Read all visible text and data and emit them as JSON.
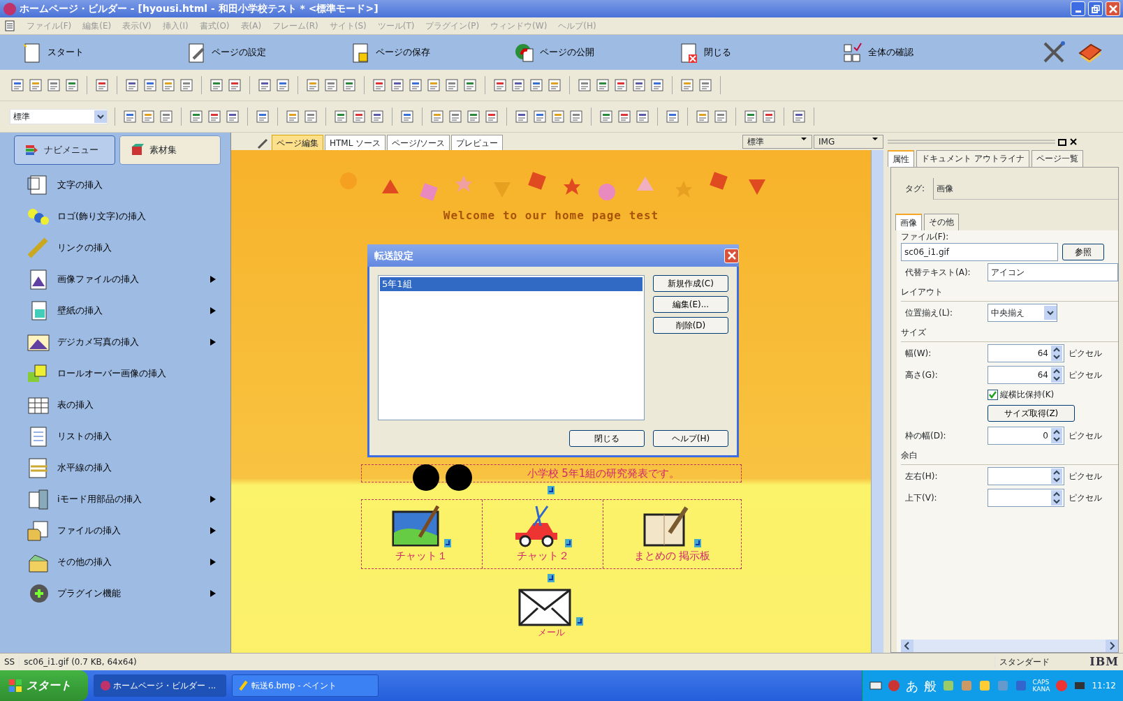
{
  "window": {
    "title": "ホームページ・ビルダー - [hyousi.html - 和田小学校テスト * <標準モード>]"
  },
  "menu": [
    "ファイル(F)",
    "編集(E)",
    "表示(V)",
    "挿入(I)",
    "書式(O)",
    "表(A)",
    "フレーム(R)",
    "サイト(S)",
    "ツール(T)",
    "プラグイン(P)",
    "ウィンドウ(W)",
    "ヘルプ(H)"
  ],
  "task_bar": [
    {
      "label": "スタート",
      "kind": "page"
    },
    {
      "label": "ページの設定",
      "kind": "settings"
    },
    {
      "label": "ページの保存",
      "kind": "save"
    },
    {
      "label": "ページの公開",
      "kind": "publish"
    },
    {
      "label": "閉じる",
      "kind": "close"
    },
    {
      "label": "全体の確認",
      "kind": "check"
    }
  ],
  "format_bar": {
    "style": "標準"
  },
  "sidebar": {
    "tabs": [
      {
        "label": "ナビメニュー",
        "selected": true
      },
      {
        "label": "素材集",
        "selected": false
      }
    ],
    "items": [
      {
        "label": "文字の挿入",
        "submenu": false
      },
      {
        "label": "ロゴ(飾り文字)の挿入",
        "submenu": false
      },
      {
        "label": "リンクの挿入",
        "submenu": false
      },
      {
        "label": "画像ファイルの挿入",
        "submenu": true
      },
      {
        "label": "壁紙の挿入",
        "submenu": true
      },
      {
        "label": "デジカメ写真の挿入",
        "submenu": true
      },
      {
        "label": "ロールオーバー画像の挿入",
        "submenu": false
      },
      {
        "label": "表の挿入",
        "submenu": false
      },
      {
        "label": "リストの挿入",
        "submenu": false
      },
      {
        "label": "水平線の挿入",
        "submenu": false
      },
      {
        "label": "iモード用部品の挿入",
        "submenu": true
      },
      {
        "label": "ファイルの挿入",
        "submenu": true
      },
      {
        "label": "その他の挿入",
        "submenu": true
      },
      {
        "label": "プラグイン機能",
        "submenu": true
      }
    ]
  },
  "editor": {
    "tabs": [
      {
        "label": "ページ編集",
        "selected": true
      },
      {
        "label": "HTML ソース",
        "selected": false
      },
      {
        "label": "ページ/ソース",
        "selected": false
      },
      {
        "label": "プレビュー",
        "selected": false
      }
    ],
    "selects": [
      "標準",
      "IMG"
    ],
    "page": {
      "heading": "Welcome to our home page  test",
      "intro": "小学校  5年1組の研究発表です。",
      "links": [
        {
          "label": "チャット１",
          "kind": "paint"
        },
        {
          "label": "チャット２",
          "kind": "craft"
        },
        {
          "label": "まとめの 掲示板",
          "kind": "note"
        }
      ],
      "mail_label": "メール"
    }
  },
  "dialog": {
    "title": "転送設定",
    "list": [
      {
        "label": "5年1組",
        "selected": true
      }
    ],
    "side_buttons": [
      "新規作成(C)",
      "編集(E)...",
      "削除(D)"
    ],
    "footer_buttons": [
      "閉じる",
      "ヘルプ(H)"
    ]
  },
  "properties": {
    "tabs": [
      {
        "label": "属性",
        "selected": true
      },
      {
        "label": "ドキュメント アウトライナ",
        "selected": false
      },
      {
        "label": "ページ一覧",
        "selected": false
      }
    ],
    "tag_label": "タグ:",
    "tag_value": "画像",
    "subtabs": [
      {
        "label": "画像",
        "selected": true
      },
      {
        "label": "その他",
        "selected": false
      }
    ],
    "file_label": "ファイル(F):",
    "file_value": "sc06_i1.gif",
    "browse_button": "参照",
    "alt_label": "代替テキスト(A):",
    "alt_value": "アイコン",
    "layout_heading": "レイアウト",
    "align_label": "位置揃え(L):",
    "align_value": "中央揃え",
    "size_heading": "サイズ",
    "width": {
      "label": "幅(W):",
      "value": "64",
      "unit": "ピクセル"
    },
    "height": {
      "label": "高さ(G):",
      "value": "64",
      "unit": "ピクセル"
    },
    "keep_ratio": {
      "label": "縦横比保持(K)",
      "checked": true
    },
    "get_size_button": "サイズ取得(Z)",
    "border": {
      "label": "枠の幅(D):",
      "value": "0",
      "unit": "ピクセル"
    },
    "margin_heading": "余白",
    "hspace": {
      "label": "左右(H):",
      "unit": "ピクセル"
    },
    "vspace": {
      "label": "上下(V):",
      "unit": "ピクセル"
    }
  },
  "status_bar": {
    "mode": "SS",
    "file": "sc06_i1.gif (0.7 KB, 64x64)",
    "layout": "スタンダード",
    "brand": "IBM"
  },
  "taskbar": {
    "start": "スタート",
    "tasks": [
      {
        "label": "ホームページ・ビルダー ...",
        "selected": true
      },
      {
        "label": "転送6.bmp - ペイント",
        "selected": false
      }
    ],
    "tray": [
      "あ",
      "般"
    ],
    "caps": "CAPS",
    "kana": "KANA",
    "time": "11:12"
  }
}
